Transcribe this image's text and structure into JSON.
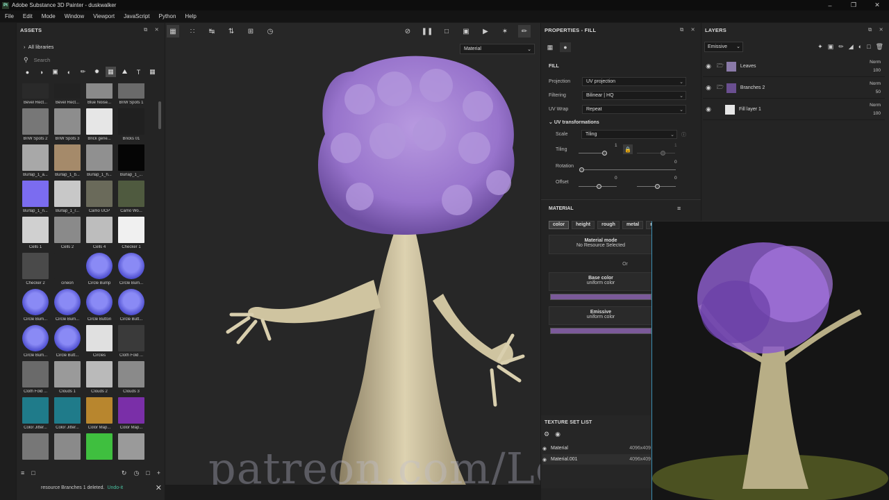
{
  "window": {
    "title": "Adobe Substance 3D Painter - duskwalker",
    "app_icon": "Pt"
  },
  "menu": [
    "File",
    "Edit",
    "Mode",
    "Window",
    "Viewport",
    "JavaScript",
    "Python",
    "Help"
  ],
  "assets": {
    "title": "ASSETS",
    "library": "All libraries",
    "search_placeholder": "Search",
    "items": [
      {
        "label": "Bevel Rect...",
        "color": "#2a2a2a"
      },
      {
        "label": "Bevel Rect...",
        "color": "#222"
      },
      {
        "label": "Blue Noise...",
        "color": "#8a8a8a"
      },
      {
        "label": "BnW Spots 1",
        "color": "#6a6a6a"
      },
      {
        "label": "BnW Spots 2",
        "color": "#777"
      },
      {
        "label": "BnW Spots 3",
        "color": "#8d8d8d"
      },
      {
        "label": "Brick gene...",
        "color": "#e6e6e6"
      },
      {
        "label": "Bricks 01",
        "color": "#202020"
      },
      {
        "label": "Burlap_1_a...",
        "color": "#a8a8a8"
      },
      {
        "label": "Burlap_1_b...",
        "color": "#a58a6a"
      },
      {
        "label": "Burlap_1_h...",
        "color": "#909090"
      },
      {
        "label": "Burlap_1_...",
        "color": "#050505"
      },
      {
        "label": "Burlap_1_n...",
        "color": "#7b6cf0"
      },
      {
        "label": "Burlap_1_r...",
        "color": "#c8c8c8"
      },
      {
        "label": "Camo UCP",
        "color": "#6a6a5a"
      },
      {
        "label": "Camo Wo...",
        "color": "#4f5a3f"
      },
      {
        "label": "Cells 1",
        "color": "#d0d0d0"
      },
      {
        "label": "Cells 2",
        "color": "#8a8a8a"
      },
      {
        "label": "Cells 4",
        "color": "#bdbdbd"
      },
      {
        "label": "Checker 1",
        "color": "#f0f0f0"
      },
      {
        "label": "Checker 2",
        "color": "#4a4a4a"
      },
      {
        "label": "cineon",
        "color": "#242424"
      },
      {
        "label": "Circle Bump",
        "color": "#6e6ee8"
      },
      {
        "label": "Circle Bum...",
        "color": "#6e6ee8"
      },
      {
        "label": "Circle Bum...",
        "color": "#6e6ee8"
      },
      {
        "label": "Circle Bum...",
        "color": "#6e6ee8"
      },
      {
        "label": "Circle Button",
        "color": "#6e6ee8"
      },
      {
        "label": "Circle Butt...",
        "color": "#6e6ee8"
      },
      {
        "label": "Circle Bum...",
        "color": "#6e6ee8"
      },
      {
        "label": "Circle Butt...",
        "color": "#6e6ee8"
      },
      {
        "label": "Circles",
        "color": "#e0e0e0"
      },
      {
        "label": "Cloth Fold ...",
        "color": "#3a3a3a"
      },
      {
        "label": "Cloth Fold ...",
        "color": "#6a6a6a"
      },
      {
        "label": "Clouds 1",
        "color": "#9a9a9a"
      },
      {
        "label": "Clouds 2",
        "color": "#bababa"
      },
      {
        "label": "Clouds 3",
        "color": "#8a8a8a"
      },
      {
        "label": "Color Jitter...",
        "color": "#1f7b8a"
      },
      {
        "label": "Color Jitter...",
        "color": "#1f7b8a"
      },
      {
        "label": "Color Map...",
        "color": "#b8862e"
      },
      {
        "label": "Color Map...",
        "color": "#7a2fa8"
      },
      {
        "label": "",
        "color": "#777"
      },
      {
        "label": "",
        "color": "#8a8a8a"
      },
      {
        "label": "",
        "color": "#3fbf3f"
      },
      {
        "label": "",
        "color": "#9a9a9a"
      }
    ],
    "status_text": "resource Branches 1 deleted.",
    "undo_text": "Undo-it"
  },
  "viewport": {
    "material_select": "Material",
    "watermark": "patreon.com/Lodaini"
  },
  "properties": {
    "title": "PROPERTIES - FILL",
    "fill_section": "FILL",
    "projection_label": "Projection",
    "projection_value": "UV projection",
    "filtering_label": "Filtering",
    "filtering_value": "Bilinear | HQ",
    "uvwrap_label": "UV Wrap",
    "uvwrap_value": "Repeat",
    "uvtrans_label": "UV transformations",
    "scale_label": "Scale",
    "scale_value": "Tiling",
    "tiling_label": "Tiling",
    "tiling_value": "1",
    "tiling_value2": "1",
    "rotation_label": "Rotation",
    "rotation_value": "0",
    "offset_label": "Offset",
    "offset_value1": "0",
    "offset_value2": "0",
    "material_section": "MATERIAL",
    "channels": [
      "color",
      "height",
      "rough",
      "metal",
      "r"
    ],
    "material_mode_title": "Material mode",
    "material_mode_value": "No Resource Selected",
    "or_text": "Or",
    "base_color_title": "Base color",
    "base_color_value": "uniform color",
    "base_color_hex": "#7b5a9a",
    "emissive_title": "Emissive",
    "emissive_value": "uniform color",
    "emissive_hex": "#7b5a9a"
  },
  "texture_set_list": {
    "title": "TEXTURE SET LIST",
    "rows": [
      {
        "name": "Material",
        "res": "4096x409"
      },
      {
        "name": "Material.001",
        "res": "4096x409"
      }
    ]
  },
  "layers": {
    "title": "LAYERS",
    "blend_mode": "Emissive",
    "items": [
      {
        "name": "Leaves",
        "mode": "Norm",
        "opacity": "100"
      },
      {
        "name": "Branches 2",
        "mode": "Norm",
        "opacity": "50"
      },
      {
        "name": "Fill layer 1",
        "mode": "Norm",
        "opacity": "100"
      }
    ]
  }
}
